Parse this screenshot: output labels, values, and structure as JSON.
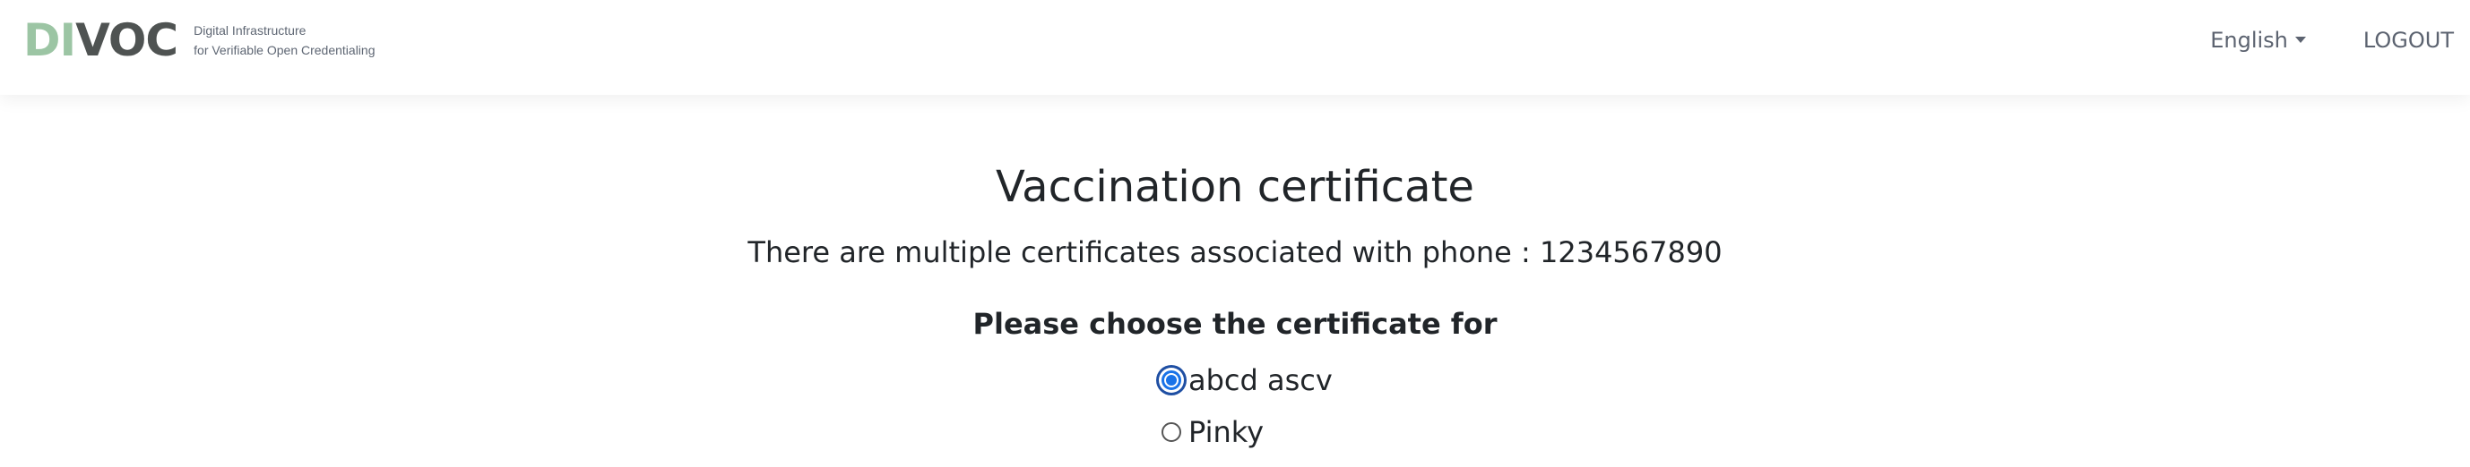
{
  "header": {
    "logo": {
      "part1": "DI",
      "part2": "VOC"
    },
    "tagline": {
      "line1": "Digital Infrastructure",
      "line2": "for Verifiable Open Credentialing"
    },
    "language": "English",
    "logout": "LOGOUT"
  },
  "main": {
    "title": "Vaccination certificate",
    "subtitle": "There are multiple certificates associated with phone : 1234567890",
    "prompt": "Please choose the certificate for",
    "options": [
      {
        "label": "abcd ascv",
        "selected": true
      },
      {
        "label": "Pinky",
        "selected": false
      }
    ]
  },
  "colors": {
    "logo_accent": "#9cc5a4",
    "logo_dark": "#4f5352",
    "radio_selected": "#1a73e8"
  },
  "icons": {
    "language_dropdown": "chevron-down-icon"
  }
}
